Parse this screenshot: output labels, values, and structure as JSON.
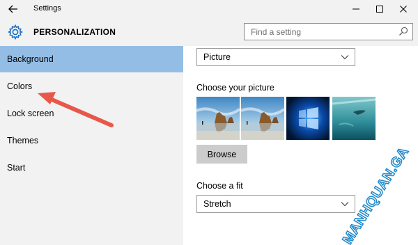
{
  "window": {
    "title": "Settings"
  },
  "header": {
    "title": "PERSONALIZATION",
    "search_placeholder": "Find a setting"
  },
  "sidebar": {
    "items": [
      {
        "label": "Background",
        "active": true
      },
      {
        "label": "Colors",
        "active": false
      },
      {
        "label": "Lock screen",
        "active": false
      },
      {
        "label": "Themes",
        "active": false
      },
      {
        "label": "Start",
        "active": false
      }
    ]
  },
  "content": {
    "background_select": {
      "value": "Picture"
    },
    "choose_picture_label": "Choose your picture",
    "thumbnails": [
      {
        "name": "rock-beach-sunrise"
      },
      {
        "name": "rock-beach-sunrise"
      },
      {
        "name": "windows-logo-blue"
      },
      {
        "name": "underwater-swimmer"
      }
    ],
    "browse_label": "Browse",
    "choose_fit_label": "Choose a fit",
    "fit_select": {
      "value": "Stretch"
    }
  },
  "annotation": {
    "arrow_color": "#e8584a"
  },
  "watermark": {
    "text": "MANHQUAN.GA"
  },
  "colors": {
    "accent": "#94bde6",
    "chrome": "#f2f2f2",
    "button": "#cccccc"
  },
  "icons": [
    "back-arrow-icon",
    "minimize-icon",
    "maximize-icon",
    "close-icon",
    "gear-icon",
    "search-icon",
    "chevron-down-icon"
  ]
}
